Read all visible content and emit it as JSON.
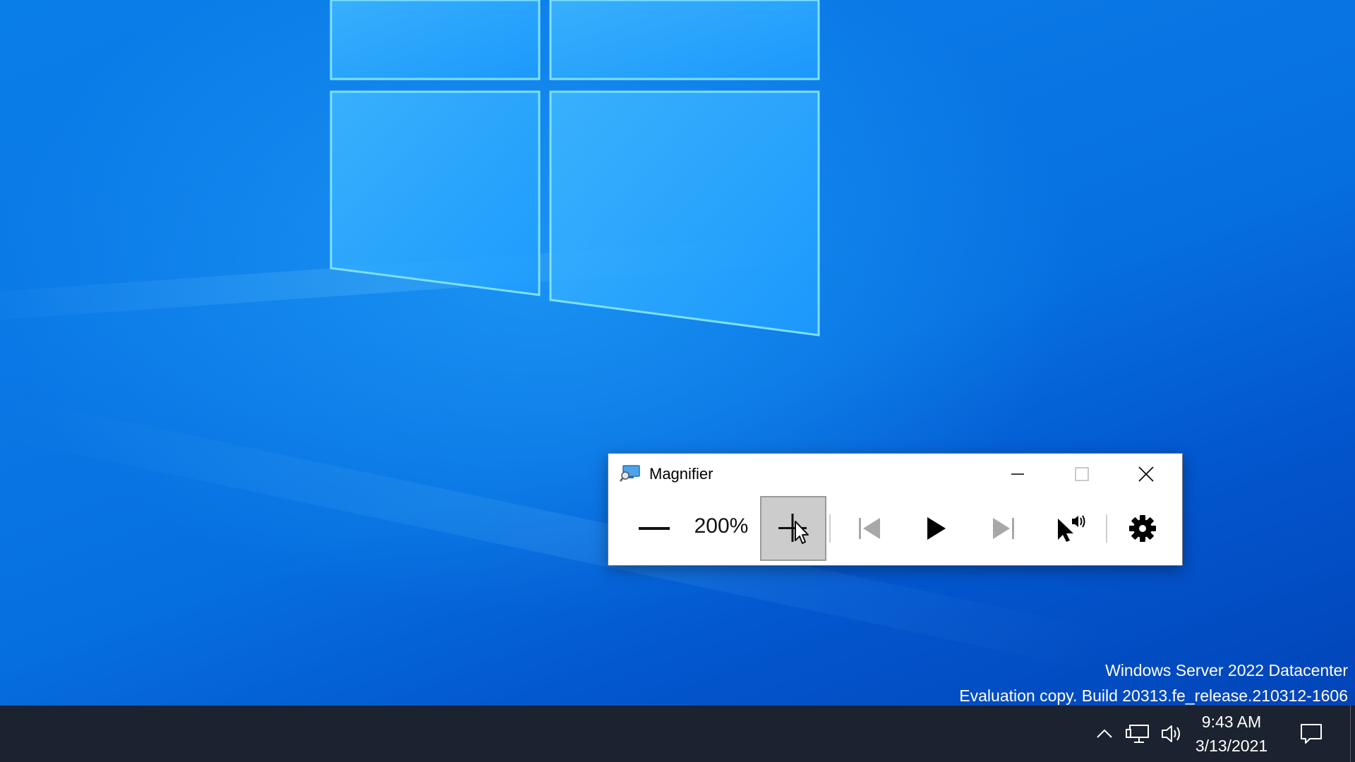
{
  "magnifier": {
    "title": "Magnifier",
    "zoom_level": "200%",
    "caption_buttons": [
      "minimize",
      "maximize",
      "close"
    ],
    "toolbar": [
      {
        "name": "zoom-out",
        "icon": "minus-icon"
      },
      {
        "name": "zoom-in",
        "icon": "plus-icon",
        "state": "pressed"
      },
      {
        "name": "previous-paragraph",
        "icon": "skip-back-icon",
        "state": "disabled"
      },
      {
        "name": "read",
        "icon": "play-icon"
      },
      {
        "name": "next-paragraph",
        "icon": "skip-forward-icon",
        "state": "disabled"
      },
      {
        "name": "read-from-here",
        "icon": "pointer-speaker-icon"
      },
      {
        "name": "settings",
        "icon": "gear-icon"
      }
    ]
  },
  "watermark": {
    "line1": "Windows Server 2022 Datacenter",
    "line2": "Evaluation copy. Build 20313.fe_release.210312-1606"
  },
  "taskbar": {
    "time": "9:43 AM",
    "date": "3/13/2021",
    "tray_icons": [
      "chevron-up-icon",
      "network-icon",
      "volume-icon",
      "notification-icon"
    ]
  },
  "colors": {
    "desktop_blue": "#0a78e6",
    "taskbar": "#1b2230",
    "pressed_button": "#cccccc"
  }
}
